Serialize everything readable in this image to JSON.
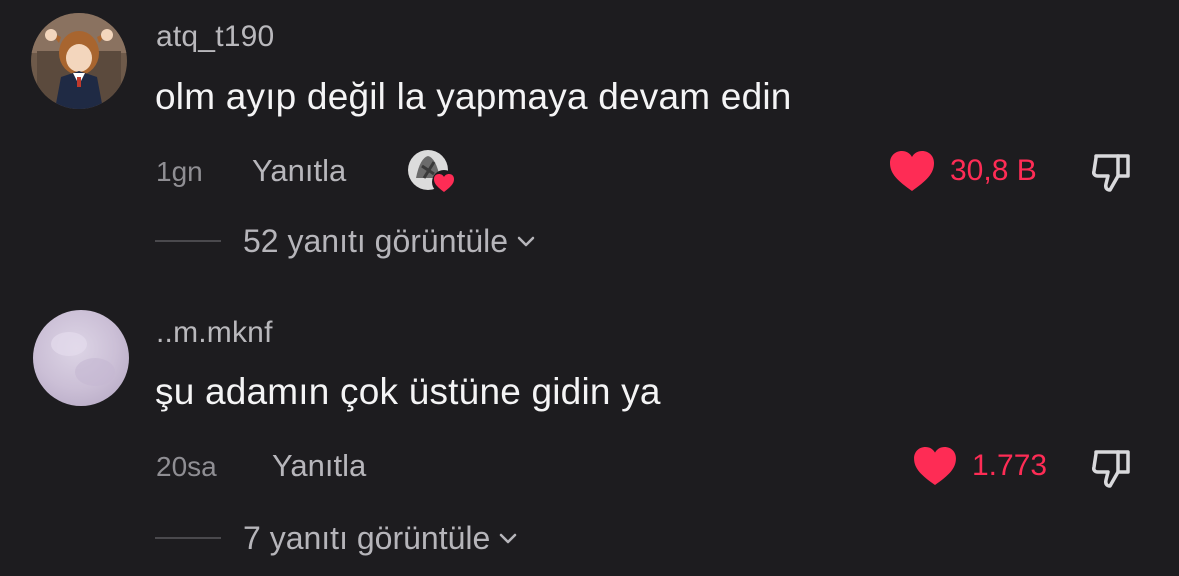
{
  "comments": [
    {
      "username": "atq_t190",
      "text": "olm ayıp değil la yapmaya devam edin",
      "time": "1gn",
      "reply_label": "Yanıtla",
      "likes": "30,8 B",
      "view_replies": "52 yanıtı görüntüle",
      "creator_liked": true
    },
    {
      "username": "..m.mknf",
      "text": "şu adamın çok üstüne gidin ya",
      "time": "20sa",
      "reply_label": "Yanıtla",
      "likes": "1.773",
      "view_replies": "7 yanıtı görüntüle",
      "creator_liked": false
    }
  ],
  "colors": {
    "background": "#1d1c1f",
    "like": "#fe2c55",
    "muted": "#8f8e93"
  },
  "icons": {
    "like": "heart-icon",
    "dislike": "thumbs-down-icon",
    "expand": "chevron-down-icon"
  }
}
